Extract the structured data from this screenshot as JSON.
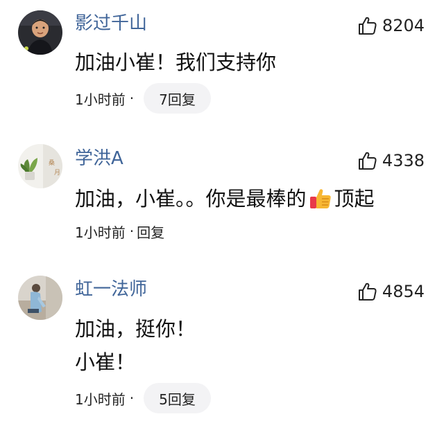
{
  "comments": [
    {
      "username": "影过千山",
      "like_icon": "thumbs-up-outline",
      "likes": "8204",
      "lines": [
        "加油小崔！我们支持你"
      ],
      "time": "1小时前",
      "separator": "·",
      "reply_label": "7回复"
    },
    {
      "username": "学洪A",
      "like_icon": "thumbs-up-outline",
      "likes": "4338",
      "line_before_emoji": "加油，小崔。。你是最棒的",
      "emoji": "thumbs-up-emoji",
      "line_after_emoji": "顶起",
      "time": "1小时前",
      "separator": "·",
      "reply_label": "回复"
    },
    {
      "username": "虹一法师",
      "like_icon": "thumbs-up-outline",
      "likes": "4854",
      "lines": [
        "加油，挺你！",
        "小崔！"
      ],
      "time": "1小时前",
      "separator": "·",
      "reply_label": "5回复"
    }
  ],
  "colors": {
    "username": "#406599",
    "text": "#111111",
    "pill_bg": "#f3f3f5"
  }
}
